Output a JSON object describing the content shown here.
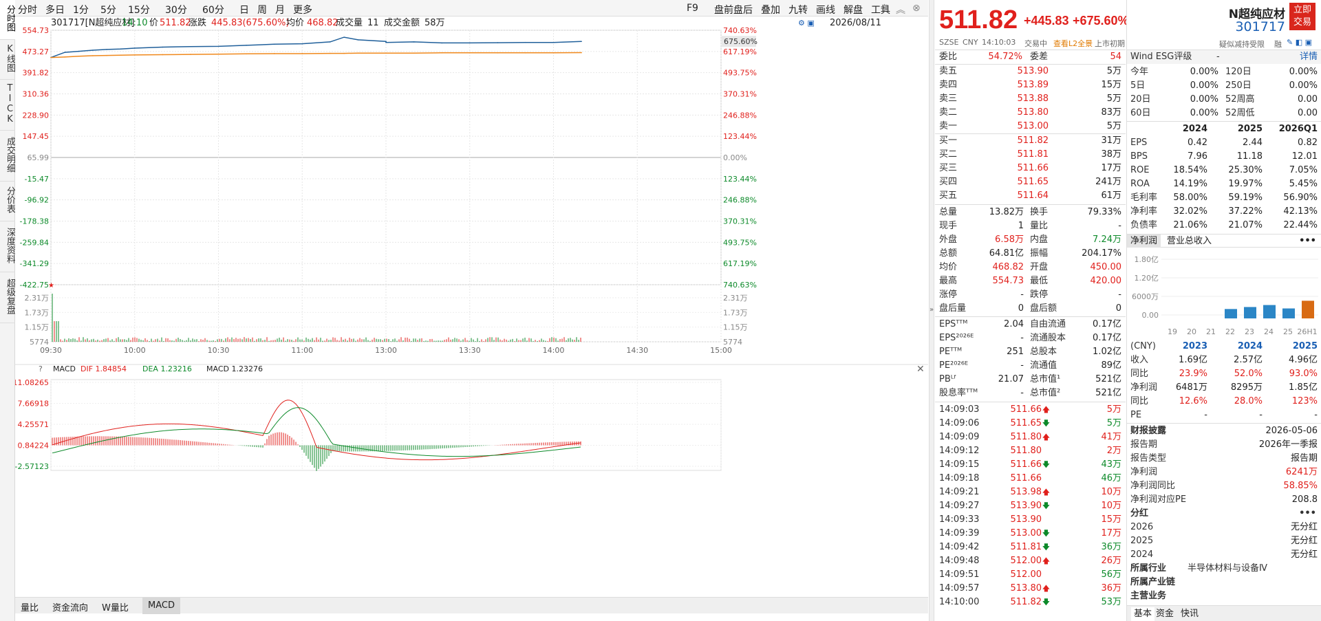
{
  "left_rail": [
    "分时图",
    "K线图",
    "TICK",
    "成交明细",
    "分价表",
    "深度资料",
    "超级复盘"
  ],
  "toolbar": {
    "left": [
      "分时",
      "多日",
      "1分",
      "5分",
      "15分",
      "30分",
      "60分",
      "日",
      "周",
      "月",
      "更多"
    ],
    "right": [
      "F9",
      "盘前盘后",
      "叠加",
      "九转",
      "画线",
      "解盘",
      "工具"
    ]
  },
  "infobar": {
    "name": "301717[N超纯应材]",
    "time": "14:10",
    "price_label": "价",
    "price": "511.82",
    "change_label": "涨跌",
    "change": "445.83(675.60%)",
    "avg_label": "均价",
    "avg": "468.82",
    "vol_label": "成交量",
    "vol": "11",
    "amt_label": "成交金额",
    "amt": "58万",
    "date": "2026/08/11"
  },
  "price_axis_left": [
    "554.73",
    "473.27",
    "391.82",
    "310.36",
    "228.90",
    "147.45",
    "65.99",
    "-15.47",
    "-96.92",
    "-178.38",
    "-259.84",
    "-341.29",
    "-422.75"
  ],
  "price_axis_right": [
    "740.63%",
    "617.19%",
    "493.75%",
    "370.31%",
    "246.88%",
    "123.44%",
    "0.00%",
    "123.44%",
    "246.88%",
    "370.31%",
    "493.75%",
    "617.19%",
    "740.63%"
  ],
  "current_pct_tag": "675.60%",
  "vol_axis": [
    "2.31万",
    "1.73万",
    "1.15万",
    "5774"
  ],
  "time_axis": [
    "09:30",
    "10:00",
    "10:30",
    "11:00",
    "13:00",
    "13:30",
    "14:00",
    "14:30",
    "15:00"
  ],
  "macd": {
    "title": "MACD",
    "dif_label": "DIF 1.84854",
    "dea_label": "DEA 1.23216",
    "macd_label": "MACD 1.23276",
    "axis": [
      "11.08265",
      "7.66918",
      "4.25571",
      "0.84224",
      "-2.57123"
    ]
  },
  "bottom_tabs": [
    "量比",
    "资金流向",
    "W量比",
    "MACD"
  ],
  "quote": {
    "price": "511.82",
    "change": "+445.83",
    "change_pct": "+675.60%",
    "exchange": "SZSE",
    "currency": "CNY",
    "time": "14:10:03",
    "status": "交易中",
    "l2": "查看L2全景",
    "listing": "上市初期",
    "weibi_label": "委比",
    "weibi": "54.72%",
    "weicha_label": "委差",
    "weicha": "54",
    "asks": [
      {
        "label": "卖五",
        "price": "513.90",
        "vol": "5万"
      },
      {
        "label": "卖四",
        "price": "513.89",
        "vol": "15万"
      },
      {
        "label": "卖三",
        "price": "513.88",
        "vol": "5万"
      },
      {
        "label": "卖二",
        "price": "513.80",
        "vol": "83万"
      },
      {
        "label": "卖一",
        "price": "513.00",
        "vol": "5万"
      }
    ],
    "bids": [
      {
        "label": "买一",
        "price": "511.82",
        "vol": "31万"
      },
      {
        "label": "买二",
        "price": "511.81",
        "vol": "38万"
      },
      {
        "label": "买三",
        "price": "511.66",
        "vol": "17万"
      },
      {
        "label": "买四",
        "price": "511.65",
        "vol": "241万"
      },
      {
        "label": "买五",
        "price": "511.64",
        "vol": "61万"
      }
    ],
    "stats": [
      {
        "l1": "总量",
        "v1": "13.82万",
        "c1": "dark",
        "l2": "换手",
        "v2": "79.33%",
        "c2": "dark"
      },
      {
        "l1": "现手",
        "v1": "1",
        "c1": "dark",
        "l2": "量比",
        "v2": "-",
        "c2": "dark"
      },
      {
        "l1": "外盘",
        "v1": "6.58万",
        "c1": "red",
        "l2": "内盘",
        "v2": "7.24万",
        "c2": "green"
      },
      {
        "l1": "总额",
        "v1": "64.81亿",
        "c1": "dark",
        "l2": "振幅",
        "v2": "204.17%",
        "c2": "dark"
      },
      {
        "l1": "均价",
        "v1": "468.82",
        "c1": "red",
        "l2": "开盘",
        "v2": "450.00",
        "c2": "red"
      },
      {
        "l1": "最高",
        "v1": "554.73",
        "c1": "red",
        "l2": "最低",
        "v2": "420.00",
        "c2": "red"
      },
      {
        "l1": "涨停",
        "v1": "-",
        "c1": "dark",
        "l2": "跌停",
        "v2": "-",
        "c2": "dark"
      },
      {
        "l1": "盘后量",
        "v1": "0",
        "c1": "dark",
        "l2": "盘后额",
        "v2": "0",
        "c2": "dark"
      }
    ],
    "stats2": [
      {
        "l1": "EPSᵀᵀᴹ",
        "v1": "2.04",
        "l2": "自由流通",
        "v2": "0.17亿"
      },
      {
        "l1": "EPS²⁰²⁶ᴱ",
        "v1": "-",
        "l2": "流通股本",
        "v2": "0.17亿"
      },
      {
        "l1": "PEᵀᵀᴹ",
        "v1": "251",
        "l2": "总股本",
        "v2": "1.02亿"
      },
      {
        "l1": "PE²⁰²⁶ᴱ",
        "v1": "-",
        "l2": "流通值",
        "v2": "89亿"
      },
      {
        "l1": "PBᴸᶠ",
        "v1": "21.07",
        "l2": "总市值¹",
        "v2": "521亿"
      },
      {
        "l1": "股息率ᵀᵀᴹ",
        "v1": "-",
        "l2": "总市值²",
        "v2": "521亿"
      }
    ],
    "ticks": [
      {
        "t": "14:09:03",
        "p": "511.66",
        "d": "up",
        "c": "red",
        "v": "5万",
        "vc": "red"
      },
      {
        "t": "14:09:06",
        "p": "511.65",
        "d": "dn",
        "c": "red",
        "v": "5万",
        "vc": "green"
      },
      {
        "t": "14:09:09",
        "p": "511.80",
        "d": "up",
        "c": "red",
        "v": "41万",
        "vc": "red"
      },
      {
        "t": "14:09:12",
        "p": "511.80",
        "d": "",
        "c": "red",
        "v": "2万",
        "vc": "red"
      },
      {
        "t": "14:09:15",
        "p": "511.66",
        "d": "dn",
        "c": "red",
        "v": "43万",
        "vc": "green"
      },
      {
        "t": "14:09:18",
        "p": "511.66",
        "d": "",
        "c": "red",
        "v": "46万",
        "vc": "green"
      },
      {
        "t": "14:09:21",
        "p": "513.98",
        "d": "up",
        "c": "red",
        "v": "10万",
        "vc": "red"
      },
      {
        "t": "14:09:27",
        "p": "513.90",
        "d": "dn",
        "c": "red",
        "v": "10万",
        "vc": "red"
      },
      {
        "t": "14:09:33",
        "p": "513.90",
        "d": "",
        "c": "red",
        "v": "15万",
        "vc": "red"
      },
      {
        "t": "14:09:39",
        "p": "513.00",
        "d": "dn",
        "c": "red",
        "v": "17万",
        "vc": "red"
      },
      {
        "t": "14:09:42",
        "p": "511.81",
        "d": "dn",
        "c": "red",
        "v": "36万",
        "vc": "green"
      },
      {
        "t": "14:09:48",
        "p": "512.00",
        "d": "up",
        "c": "red",
        "v": "26万",
        "vc": "red"
      },
      {
        "t": "14:09:51",
        "p": "512.00",
        "d": "",
        "c": "red",
        "v": "56万",
        "vc": "green"
      },
      {
        "t": "14:09:57",
        "p": "513.80",
        "d": "up",
        "c": "red",
        "v": "36万",
        "vc": "red"
      },
      {
        "t": "14:10:00",
        "p": "511.82",
        "d": "dn",
        "c": "red",
        "v": "53万",
        "vc": "green"
      },
      {
        "t": "14:10:03",
        "p": "511.82",
        "d": "",
        "c": "red",
        "v": "4万",
        "vc": "red"
      }
    ]
  },
  "info": {
    "name": "N超纯应材",
    "code": "301717",
    "trade_btn": "立即交易",
    "sub_left": "疑似减持受限",
    "sub_right": "融",
    "esg_label": "Wind ESG评级",
    "esg_value": "-",
    "esg_detail": "详情",
    "perf": [
      {
        "l1": "今年",
        "v1": "0.00%",
        "l2": "120日",
        "v2": "0.00%"
      },
      {
        "l1": "5日",
        "v1": "0.00%",
        "l2": "250日",
        "v2": "0.00%"
      },
      {
        "l1": "20日",
        "v1": "0.00%",
        "l2": "52周高",
        "v2": "0.00"
      },
      {
        "l1": "60日",
        "v1": "0.00%",
        "l2": "52周低",
        "v2": "0.00"
      }
    ],
    "fin_years": [
      "2024",
      "2025",
      "2026Q1"
    ],
    "fin_rows": [
      {
        "l": "EPS",
        "v": [
          "0.42",
          "2.44",
          "0.82"
        ]
      },
      {
        "l": "BPS",
        "v": [
          "7.96",
          "11.18",
          "12.01"
        ]
      },
      {
        "l": "ROE",
        "v": [
          "18.54%",
          "25.30%",
          "7.05%"
        ]
      },
      {
        "l": "ROA",
        "v": [
          "14.19%",
          "19.97%",
          "5.45%"
        ]
      },
      {
        "l": "毛利率",
        "v": [
          "58.00%",
          "59.19%",
          "56.90%"
        ]
      },
      {
        "l": "净利率",
        "v": [
          "32.02%",
          "37.22%",
          "42.13%"
        ]
      },
      {
        "l": "负债率",
        "v": [
          "21.06%",
          "21.07%",
          "22.44%"
        ]
      }
    ],
    "profit_tab": "净利润",
    "revenue_tab": "营业总收入",
    "profit_axis": [
      "1.80亿",
      "1.20亿",
      "6000万",
      "0.00"
    ],
    "profit_years": [
      "19",
      "20",
      "21",
      "22",
      "23",
      "24",
      "25",
      "26H1"
    ],
    "cny": "(CNY)",
    "rev_years": [
      "2023",
      "2024",
      "2025"
    ],
    "rev_rows": [
      {
        "l": "收入",
        "v": [
          "1.69亿",
          "2.57亿",
          "4.96亿"
        ],
        "c": "dark"
      },
      {
        "l": "同比",
        "v": [
          "23.9%",
          "52.0%",
          "93.0%"
        ],
        "c": "red"
      },
      {
        "l": "净利润",
        "v": [
          "6481万",
          "8295万",
          "1.85亿"
        ],
        "c": "dark"
      },
      {
        "l": "同比",
        "v": [
          "12.6%",
          "28.0%",
          "123%"
        ],
        "c": "red"
      },
      {
        "l": "PE",
        "v": [
          "-",
          "-",
          "-"
        ],
        "c": "dark"
      }
    ],
    "disclosure_title": "财报披露",
    "disclosure_date": "2026-05-06",
    "report_rows": [
      {
        "l": "报告期",
        "v": "2026年一季报",
        "c": "dark"
      },
      {
        "l": "报告类型",
        "v": "报告期",
        "c": "dark"
      },
      {
        "l": "净利润",
        "v": "6241万",
        "c": "red"
      },
      {
        "l": "净利润同比",
        "v": "58.85%",
        "c": "red"
      },
      {
        "l": "净利润对应PE",
        "v": "208.8",
        "c": "dark"
      }
    ],
    "dividend_title": "分红",
    "dividends": [
      {
        "y": "2026",
        "v": "无分红"
      },
      {
        "y": "2025",
        "v": "无分红"
      },
      {
        "y": "2024",
        "v": "无分红"
      }
    ],
    "industry_label": "所属行业",
    "industry": "半导体材料与设备Ⅳ",
    "chain_label": "所属产业链",
    "business_label": "主营业务",
    "bottom_tabs": [
      "基本",
      "资金",
      "快讯"
    ]
  },
  "chart_data": {
    "type": "line",
    "x": [
      "09:30",
      "09:35",
      "09:40",
      "09:45",
      "09:50",
      "09:55",
      "10:00",
      "10:10",
      "10:20",
      "10:30",
      "10:40",
      "10:50",
      "11:00",
      "11:10",
      "11:15",
      "11:20",
      "11:30",
      "13:00",
      "13:10",
      "13:20",
      "13:30",
      "13:40",
      "13:50",
      "14:00",
      "14:10"
    ],
    "series": [
      {
        "name": "价",
        "values": [
          450,
          470,
          474,
          478,
          481,
          483,
          486,
          490,
          492,
          493,
          497,
          501,
          503,
          510,
          528,
          518,
          512,
          508,
          510,
          506,
          506,
          507,
          508,
          508,
          511.82
        ]
      },
      {
        "name": "均价",
        "values": [
          450,
          452,
          455,
          457,
          458,
          459,
          460,
          461,
          462,
          463,
          464,
          465,
          465,
          466,
          466,
          467,
          467,
          467,
          467,
          468,
          468,
          468,
          468,
          468,
          468.82
        ]
      }
    ],
    "ylim": [
      -422.75,
      554.73
    ],
    "y2lim": [
      "-740.63%",
      "740.63%"
    ],
    "grid": true
  }
}
